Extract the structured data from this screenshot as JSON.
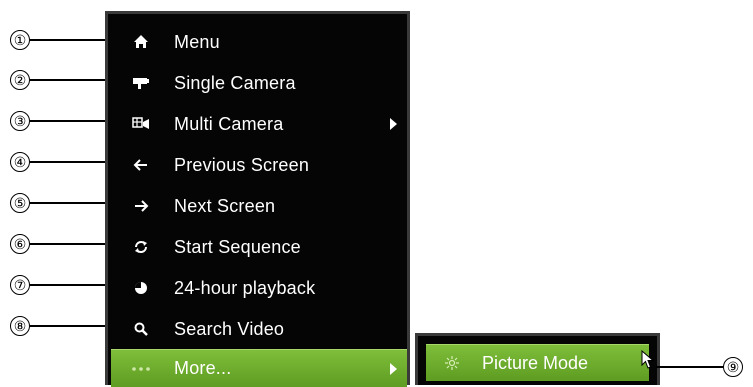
{
  "menu": {
    "items": [
      {
        "label": "Menu",
        "icon": "home-icon"
      },
      {
        "label": "Single Camera",
        "icon": "camera-icon"
      },
      {
        "label": "Multi Camera",
        "icon": "multi-camera-icon",
        "has_submenu": true
      },
      {
        "label": "Previous Screen",
        "icon": "arrow-left-icon"
      },
      {
        "label": "Next Screen",
        "icon": "arrow-right-icon"
      },
      {
        "label": "Start Sequence",
        "icon": "sequence-icon"
      },
      {
        "label": "24-hour playback",
        "icon": "playback-icon"
      },
      {
        "label": "Search Video",
        "icon": "search-icon"
      },
      {
        "label": "More...",
        "icon": "dots-icon",
        "has_submenu": true,
        "selected": true
      }
    ]
  },
  "submenu": {
    "items": [
      {
        "label": "Picture Mode",
        "icon": "picture-mode-icon",
        "selected": true
      }
    ]
  },
  "callouts": [
    "①",
    "②",
    "③",
    "④",
    "⑤",
    "⑥",
    "⑦",
    "⑧",
    "⑨"
  ],
  "colors": {
    "menu_bg": "#050505",
    "highlight": "#6faf2e",
    "text": "#ffffff"
  }
}
